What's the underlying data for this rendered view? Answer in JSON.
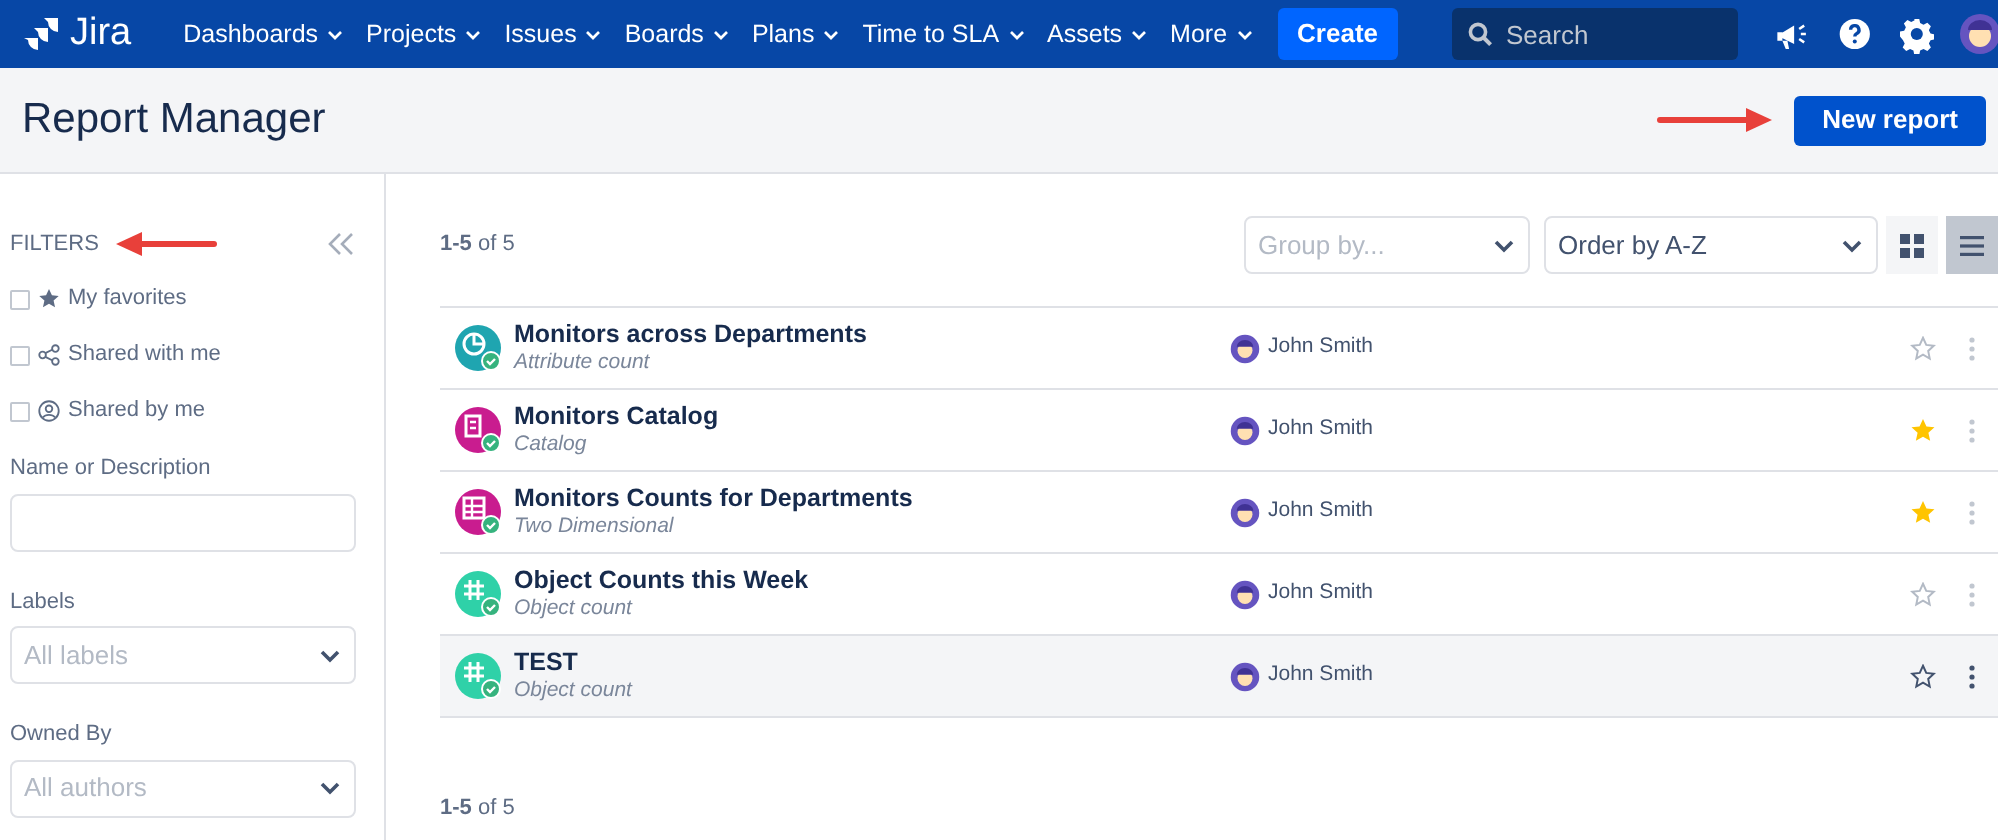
{
  "nav": {
    "logo": "Jira",
    "menus": [
      {
        "label": "Dashboards"
      },
      {
        "label": "Projects"
      },
      {
        "label": "Issues"
      },
      {
        "label": "Boards"
      },
      {
        "label": "Plans"
      },
      {
        "label": "Time to SLA"
      },
      {
        "label": "Assets"
      },
      {
        "label": "More"
      }
    ],
    "create": "Create",
    "search": {
      "placeholder": "Search"
    }
  },
  "header": {
    "title": "Report Manager",
    "new_report": "New report"
  },
  "filters": {
    "title": "FILTERS",
    "checks": [
      {
        "kind": "star",
        "label": "My favorites",
        "checked": false
      },
      {
        "kind": "share",
        "label": "Shared with me",
        "checked": false
      },
      {
        "kind": "person",
        "label": "Shared by me",
        "checked": false
      }
    ],
    "name_label": "Name or Description",
    "labels_label": "Labels",
    "labels_placeholder": "All labels",
    "owned_label": "Owned By",
    "owned_placeholder": "All authors"
  },
  "toolbar": {
    "count_bold": "1-5",
    "count_rest": "of 5",
    "group_placeholder": "Group by...",
    "order": "Order by A-Z",
    "views": [
      {
        "kind": "grid",
        "selected": false
      },
      {
        "kind": "list",
        "selected": true
      }
    ]
  },
  "reports": [
    {
      "kind": "chart",
      "color": "#1fa5b0",
      "name": "Monitors across Departments",
      "type": "Attribute count",
      "author": "John Smith",
      "favorite": false,
      "hovered": false
    },
    {
      "kind": "catalog",
      "color": "#c91c8f",
      "name": "Monitors Catalog",
      "type": "Catalog",
      "author": "John Smith",
      "favorite": true,
      "hovered": false
    },
    {
      "kind": "table",
      "color": "#c91c8f",
      "name": "Monitors Counts for Departments",
      "type": "Two Dimensional",
      "author": "John Smith",
      "favorite": true,
      "hovered": false
    },
    {
      "kind": "count",
      "color": "#2fd1a8",
      "name": "Object Counts this Week",
      "type": "Object count",
      "author": "John Smith",
      "favorite": false,
      "hovered": false
    },
    {
      "kind": "count",
      "color": "#2fd1a8",
      "name": "TEST",
      "type": "Object count",
      "author": "John Smith",
      "favorite": false,
      "hovered": true
    }
  ],
  "footer": {
    "count_bold": "1-5",
    "count_rest": "of 5"
  }
}
